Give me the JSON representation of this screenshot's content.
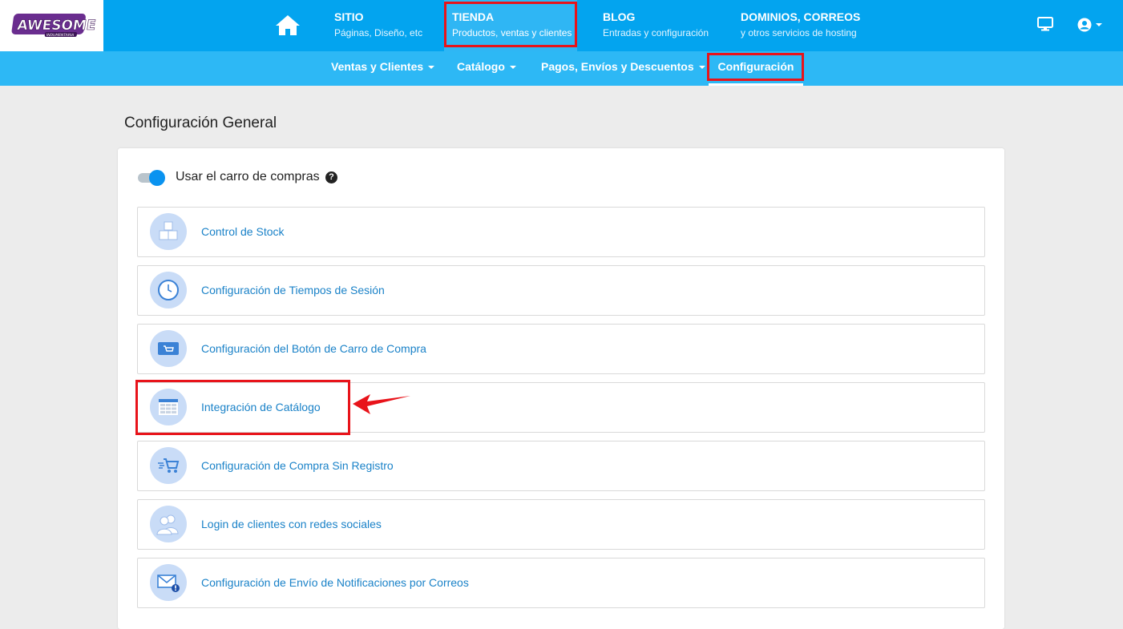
{
  "brand": {
    "logo_text": "AWESOME",
    "logo_subtext": "INDUMENTARIA",
    "logo_color": "#6a2d8f"
  },
  "topnav": {
    "home_icon": "home-icon",
    "items": [
      {
        "title": "SITIO",
        "subtitle": "Páginas, Diseño, etc"
      },
      {
        "title": "TIENDA",
        "subtitle": "Productos, ventas y clientes"
      },
      {
        "title": "BLOG",
        "subtitle": "Entradas y configuración"
      },
      {
        "title": "DOMINIOS, CORREOS",
        "subtitle": "y otros servicios de hosting"
      }
    ],
    "right_icons": [
      "monitor-icon",
      "user-account-icon"
    ]
  },
  "subnav": {
    "items": [
      {
        "label": "Ventas y Clientes"
      },
      {
        "label": "Catálogo"
      },
      {
        "label": "Pagos, Envíos y Descuentos"
      },
      {
        "label": "Configuración"
      }
    ]
  },
  "main": {
    "title": "Configuración General",
    "cart_toggle": {
      "label": "Usar el carro de compras",
      "enabled": true
    },
    "options": [
      {
        "label": "Control de Stock",
        "icon": "boxes-icon"
      },
      {
        "label": "Configuración de Tiempos de Sesión",
        "icon": "clock-icon"
      },
      {
        "label": "Configuración del Botón de Carro de Compra",
        "icon": "cart-button-icon"
      },
      {
        "label": "Integración de Catálogo",
        "icon": "catalog-table-icon"
      },
      {
        "label": "Configuración de Compra Sin Registro",
        "icon": "fast-cart-icon"
      },
      {
        "label": "Login de clientes con redes sociales",
        "icon": "users-icon"
      },
      {
        "label": "Configuración de Envío de Notificaciones por Correos",
        "icon": "mail-alert-icon"
      }
    ]
  },
  "colors": {
    "topbar": "#03a4ef",
    "subbar": "#2db8f5",
    "highlight": "#e8131a",
    "link": "#1a82c8"
  }
}
